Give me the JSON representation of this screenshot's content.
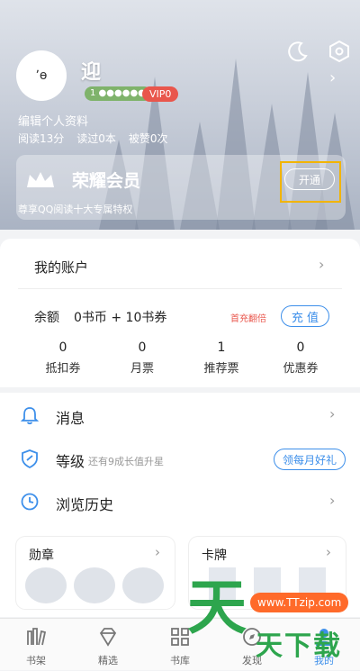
{
  "profile": {
    "avatar_glyph": "ʼɵ",
    "name": "迎",
    "level_text": "1 ●●●●●●",
    "vip": "VIP0",
    "edit": "编辑个人资料",
    "stats": [
      "阅读13分",
      "读过0本",
      "被赞0次"
    ]
  },
  "vip_card": {
    "title": "荣耀会员",
    "desc": "尊享QQ阅读十大专属特权",
    "button": "开通"
  },
  "account": {
    "title": "我的账户",
    "balance_label": "余额",
    "balance_value": "0书币 + 10书券",
    "first_charge": "首充翻倍",
    "recharge": "充 值",
    "items": [
      {
        "num": "0",
        "label": "抵扣券"
      },
      {
        "num": "0",
        "label": "月票"
      },
      {
        "num": "1",
        "label": "推荐票"
      },
      {
        "num": "0",
        "label": "优惠券"
      }
    ]
  },
  "menu": {
    "message": "消息",
    "level": "等级",
    "level_note": "还有9成长值升星",
    "daily": "领每月好礼",
    "history": "浏览历史"
  },
  "cards": {
    "medal": "勋章",
    "card": "卡牌"
  },
  "tabs": [
    "书架",
    "精选",
    "书库",
    "发现",
    "我的"
  ],
  "watermark": {
    "url": "www.TTzip.com",
    "text": "天下载"
  },
  "colors": {
    "accent": "#3d8fea",
    "vip": "#e9564c",
    "watermark": "#2da54d"
  }
}
